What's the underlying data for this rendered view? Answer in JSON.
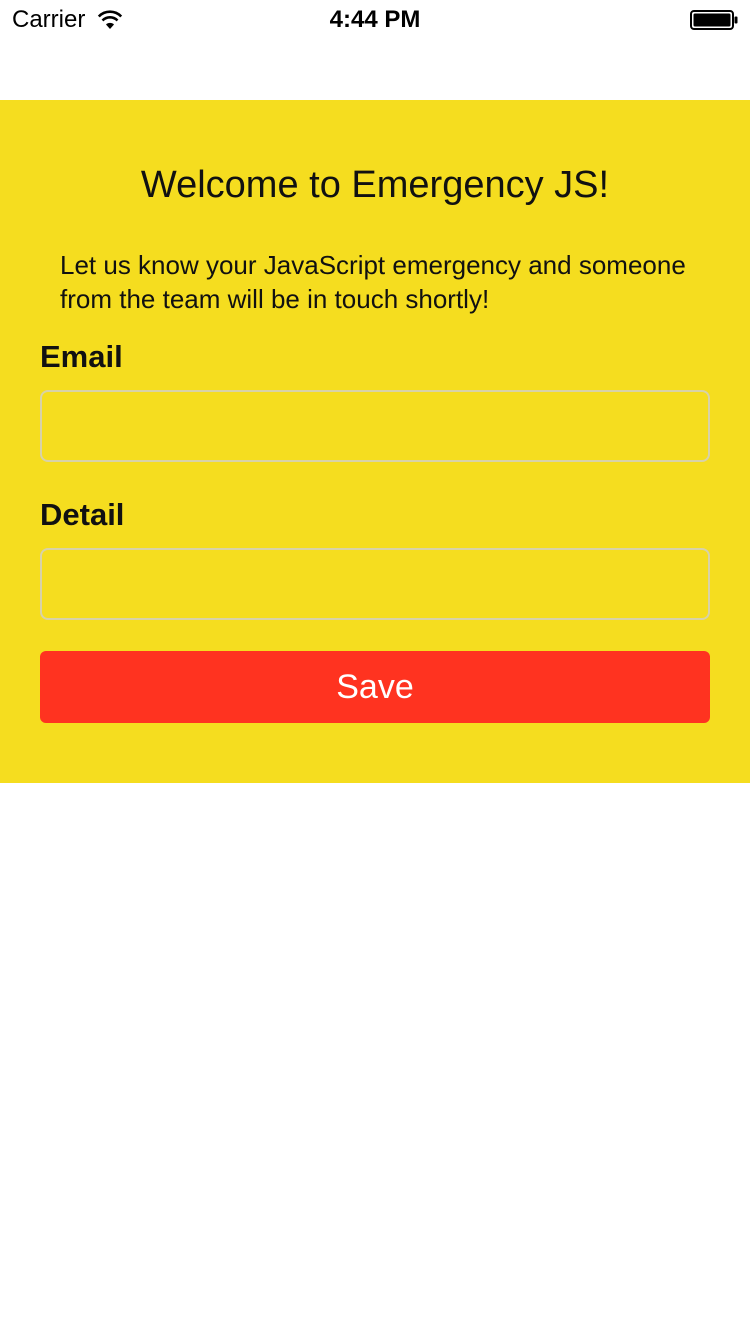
{
  "status_bar": {
    "carrier": "Carrier",
    "time": "4:44 PM",
    "icons": [
      "wifi-icon",
      "battery-icon"
    ]
  },
  "form": {
    "title": "Welcome to Emergency JS!",
    "intro": "Let us know your JavaScript emergency and someone from the team will be in touch shortly!",
    "email_label": "Email",
    "email_value": "",
    "detail_label": "Detail",
    "detail_value": "",
    "save_label": "Save"
  },
  "colors": {
    "panel_background": "#f5dd1f",
    "save_button": "#ff3320",
    "page_background": "#ffffff"
  }
}
